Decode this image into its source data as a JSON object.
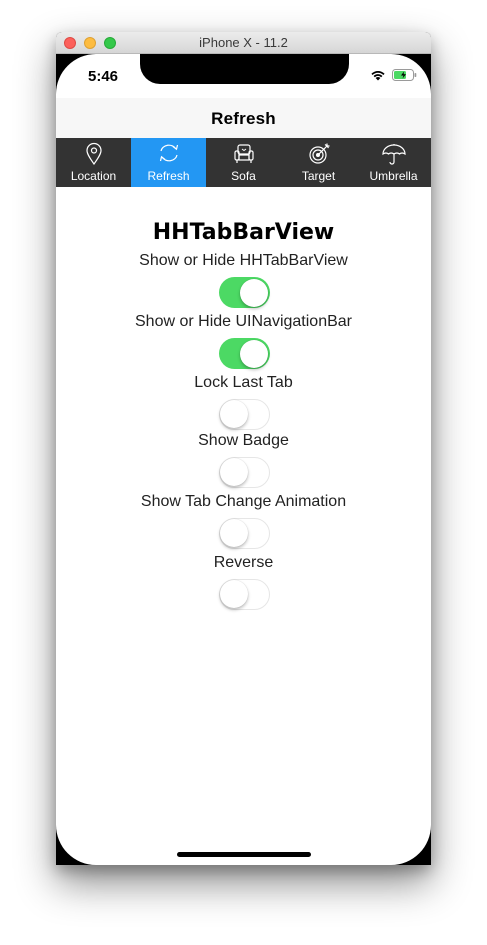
{
  "window": {
    "title": "iPhone X - 11.2"
  },
  "status_bar": {
    "time": "5:46"
  },
  "nav": {
    "title": "Refresh"
  },
  "tabs": [
    {
      "label": "Location",
      "icon": "location-pin-icon",
      "selected": false
    },
    {
      "label": "Refresh",
      "icon": "refresh-icon",
      "selected": true
    },
    {
      "label": "Sofa",
      "icon": "sofa-icon",
      "selected": false
    },
    {
      "label": "Target",
      "icon": "target-icon",
      "selected": false
    },
    {
      "label": "Umbrella",
      "icon": "umbrella-icon",
      "selected": false
    }
  ],
  "main": {
    "heading": "HHTabBarView",
    "options": [
      {
        "label": "Show or Hide HHTabBarView",
        "on": true
      },
      {
        "label": "Show or Hide UINavigationBar",
        "on": true
      },
      {
        "label": "Lock Last Tab",
        "on": false
      },
      {
        "label": "Show Badge",
        "on": false
      },
      {
        "label": "Show Tab Change Animation",
        "on": false
      },
      {
        "label": "Reverse",
        "on": false
      }
    ]
  },
  "colors": {
    "tab_bar_bg": "#333333",
    "tab_selected_bg": "#2397f3",
    "switch_on": "#4cd964",
    "battery": "#4cd964"
  }
}
